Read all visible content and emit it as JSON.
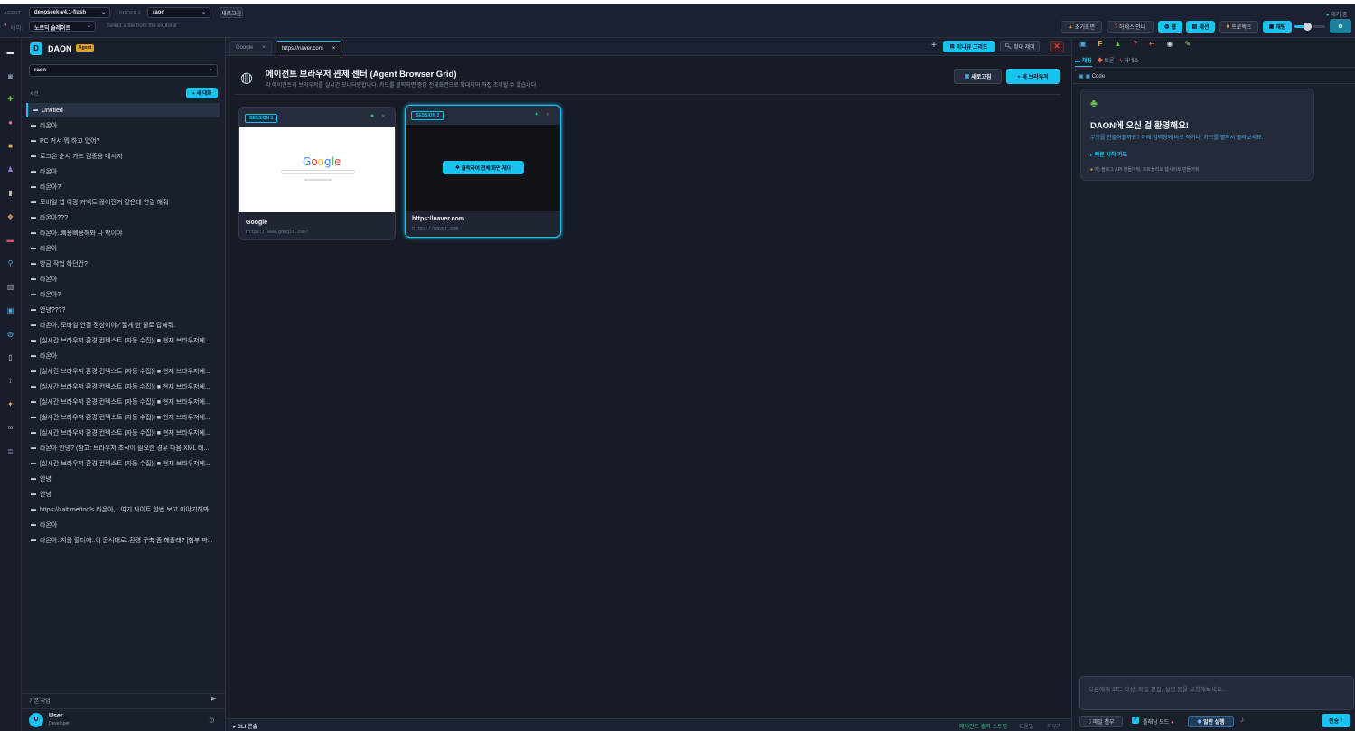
{
  "topbar": {
    "agent_label": "AGENT",
    "agent_value": "deepseek-v4.1-flash",
    "profile_label": "PROFILE",
    "profile_value": "raon",
    "refresh_label": "새로고침",
    "theme_label": "테마:",
    "theme_value": "노르딕 슬레이트",
    "file_hint": "Select a file from the explorer",
    "status": "대기 중",
    "buttons": [
      "초기화면",
      "하네스 안내",
      "웹",
      "세션",
      "프로젝트",
      "채팅"
    ]
  },
  "sidebar": {
    "brand": "DAON",
    "brand_badge": "Agent",
    "profile_select": "raon",
    "section_label": "세션",
    "new_chat": "+ 새 대화",
    "conversations": [
      "Untitled",
      "라온아",
      "PC 커서 뭐 하고 있어?",
      "로그온 순서 가드 검증용 메시지",
      "라온아",
      "라온아?",
      "모바일 앱 이랑 커넥트 끊어진거 같은데 연결 해줘",
      "라온아???",
      "라온아..삐용삐용해봐 나 밖이야",
      "라온아",
      "방금 작업 하던건?",
      "라온아",
      "라온아?",
      "안녕????",
      "라온아, 모바일 연결 정상이야? 짧게 한 줄로 답해줘.",
      "[실시간 브라우저 환경 컨텍스트 (자동 수집)] ■ 현재 브라우저에...",
      "라온아",
      "[실시간 브라우저 환경 컨텍스트 (자동 수집)] ■ 현재 브라우저에...",
      "[실시간 브라우저 환경 컨텍스트 (자동 수집)] ■ 현재 브라우저에...",
      "[실시간 브라우저 환경 컨텍스트 (자동 수집)] ■ 현재 브라우저에...",
      "[실시간 브라우저 환경 컨텍스트 (자동 수집)] ■ 현재 브라우저에...",
      "[실시간 브라우저 환경 컨텍스트 (자동 수집)] ■ 현재 브라우저에...",
      "라온아 안녕? (참고: 브라우저 조작이 필요한 경우 다음 XML 태...",
      "[실시간 브라우저 환경 컨텍스트 (자동 수집)] ■ 현재 브라우저에...",
      "안녕",
      "안녕",
      "https://zalt.me/tools 라온아, ..여기 사이트.한번 보고 이야기해봐",
      "라온아",
      "라온아..지금 폴더에..이 문서대로..환경 구축 좀 해줄래? [첨부 파..."
    ],
    "footer_label": "기본 작업",
    "user_name": "User",
    "user_role": "Developer",
    "user_initial": "U"
  },
  "main": {
    "tabs": [
      {
        "label": "Google"
      },
      {
        "label": "https://naver.com"
      }
    ],
    "mini_grid": "미니뷰 그리드",
    "expand_control": "확대 제어",
    "title": "에이전트 브라우저 관제 센터 (Agent Browser Grid)",
    "subtitle": "각 에이전트의 브라우저를 실시간 모니터링합니다. 카드를 클릭하면 중앙 전체화면으로 확대되어 직접 조작할 수 있습니다.",
    "refresh": "새로고침",
    "new_browser": "+ 새 브라우저",
    "cards": [
      {
        "session": "SESSION 1",
        "title": "Google",
        "url": "https://www.google.com/"
      },
      {
        "session": "SESSION 2",
        "title": "https://naver.com",
        "url": "https://naver.com",
        "overlay": "클릭하여 전체 화면 제어"
      }
    ],
    "google_logo": "Google",
    "cli_label": "CLI 콘솔",
    "bottom_links": [
      "에이전트 출력 스트림",
      "도움말",
      "지우기"
    ]
  },
  "right": {
    "tabs": [
      "채팅",
      "토론",
      "하네스"
    ],
    "code_label": "Code",
    "welcome_title": "DAON에 오신 걸 환영해요!",
    "welcome_sub": "무엇을 만들어볼까요? 아래 입력창에 바로 적거나, 카드를 펼쳐서 골라보세요.",
    "quick_start": "빠른 시작 카드",
    "tip": "예) 블로그 API 만들어줘, 포트폴리오 웹사이트 만들어줘",
    "input_placeholder": "다온에게 코드 작성, 파일 편집, 설명 등을 요청해보세요...",
    "attach": "파일 첨부",
    "planning": "플래닝 모드",
    "mode": "일반 실행",
    "send": "전송"
  },
  "colors": {
    "accent": "#19c3f0",
    "bg": "#161b26",
    "panel": "#1a1f2c"
  }
}
